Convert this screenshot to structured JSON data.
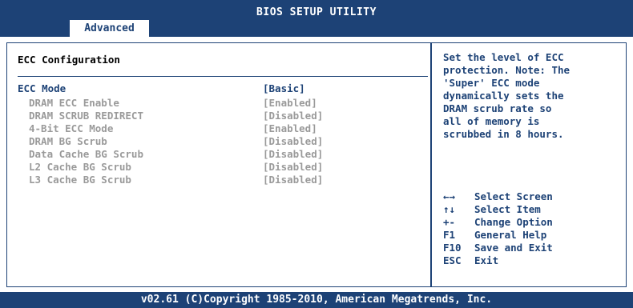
{
  "header": {
    "title": "BIOS SETUP UTILITY",
    "active_tab": "Advanced"
  },
  "left": {
    "section_title": "ECC Configuration",
    "items": [
      {
        "label": "ECC Mode",
        "value": "[Basic]"
      },
      {
        "label": "DRAM ECC Enable",
        "value": "[Enabled]"
      },
      {
        "label": "DRAM SCRUB REDIRECT",
        "value": "[Disabled]"
      },
      {
        "label": "4-Bit ECC Mode",
        "value": "[Enabled]"
      },
      {
        "label": "DRAM BG Scrub",
        "value": "[Disabled]"
      },
      {
        "label": "Data Cache BG Scrub",
        "value": "[Disabled]"
      },
      {
        "label": "L2 Cache BG Scrub",
        "value": "[Disabled]"
      },
      {
        "label": "L3 Cache BG Scrub",
        "value": "[Disabled]"
      }
    ]
  },
  "help": {
    "text": "Set the level of ECC\nprotection. Note: The\n'Super' ECC mode\ndynamically sets the\nDRAM scrub rate so\nall of memory is\nscrubbed in 8 hours."
  },
  "keys": [
    {
      "key": "←→",
      "desc": "Select Screen"
    },
    {
      "key": "↑↓",
      "desc": "Select Item"
    },
    {
      "key": "+-",
      "desc": "Change Option"
    },
    {
      "key": "F1",
      "desc": "General Help"
    },
    {
      "key": "F10",
      "desc": "Save and Exit"
    },
    {
      "key": "ESC",
      "desc": "Exit"
    }
  ],
  "footer": {
    "text": "v02.61 (C)Copyright 1985-2010, American Megatrends, Inc."
  },
  "colors": {
    "bar": "#1d4276",
    "dim_text": "#9a9a9a",
    "background": "#ffffff"
  }
}
